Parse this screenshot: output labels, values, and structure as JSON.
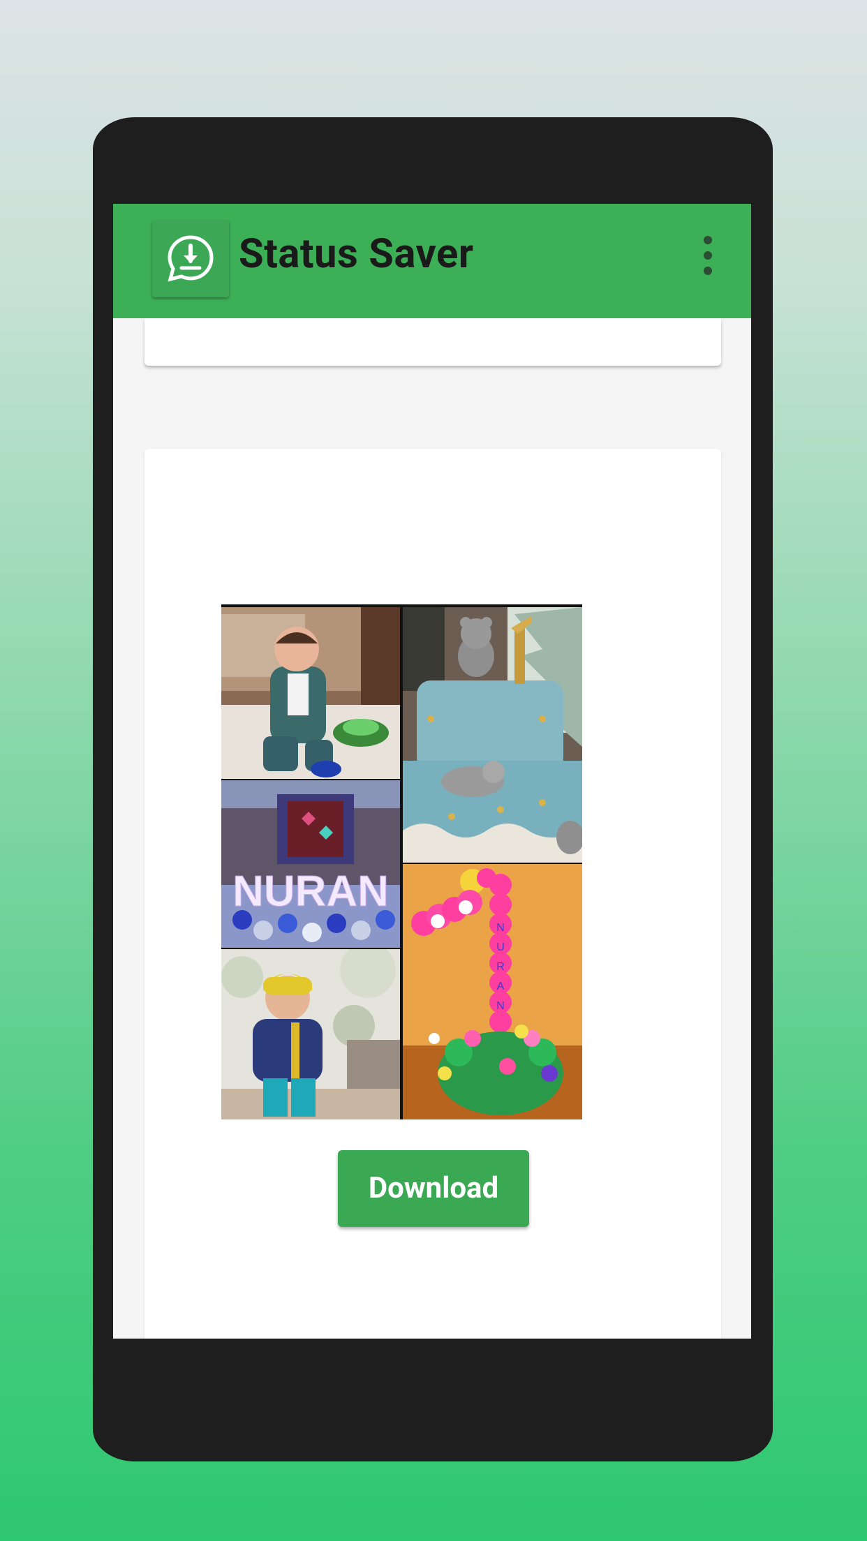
{
  "app": {
    "title": "Status Saver",
    "icon": "whatsapp-download-icon",
    "menu_icon": "more-vert-icon"
  },
  "status": {
    "collage_text": "NURAN",
    "balloon_number": "1",
    "balloon_letters": [
      "N",
      "U",
      "R",
      "A",
      "N"
    ]
  },
  "actions": {
    "download_label": "Download"
  },
  "colors": {
    "appbar": "#3daf57",
    "button": "#3ba854",
    "phone_body": "#1e1e1e"
  }
}
